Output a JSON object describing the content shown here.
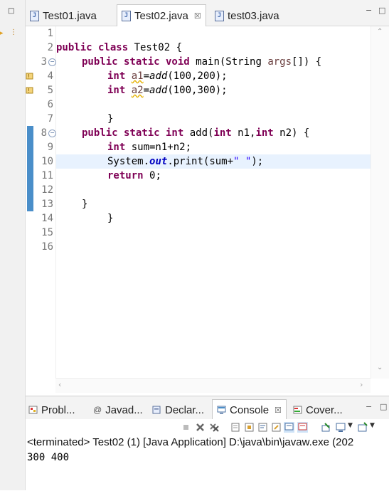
{
  "editor_tabs": [
    {
      "label": "Test01.java",
      "active": false
    },
    {
      "label": "Test02.java",
      "active": true
    },
    {
      "label": "test03.java",
      "active": false
    }
  ],
  "line_numbers": [
    "1",
    "2",
    "3",
    "4",
    "5",
    "6",
    "7",
    "8",
    "9",
    "10",
    "11",
    "12",
    "13",
    "14",
    "15",
    "16"
  ],
  "code": {
    "l2": {
      "kw": "public class ",
      "rest": "Test02 {"
    },
    "l3": {
      "kw": "public static void ",
      "rest": "main(String ",
      "arg": "args",
      "rest2": "[]) {"
    },
    "l4": {
      "kw": "int ",
      "var": "a1",
      "eq": "=",
      "fn": "add",
      "args": "(100,200);"
    },
    "l5": {
      "kw": "int ",
      "var": "a2",
      "eq": "=",
      "fn": "add",
      "args": "(100,300);"
    },
    "l7": {
      "brace": "}"
    },
    "l8": {
      "kw": "public static int ",
      "name": "add(",
      "kw2": "int ",
      "p1": "n1,",
      "kw3": "int ",
      "p2": "n2) {"
    },
    "l9": {
      "kw": "int ",
      "rest": "sum=n1+n2;"
    },
    "l10": {
      "pre": "System.",
      "field": "out",
      "mid": ".print(sum+",
      "str": "\" \"",
      "end": ");"
    },
    "l11": {
      "kw": "return ",
      "rest": "0;"
    },
    "l13": {
      "brace": "}"
    },
    "l14": {
      "brace": "}"
    }
  },
  "panel_tabs": [
    {
      "label": "Probl...",
      "icon": "problems-icon",
      "active": false
    },
    {
      "label": "Javad...",
      "icon": "javadoc-icon",
      "active": false
    },
    {
      "label": "Declar...",
      "icon": "declaration-icon",
      "active": false
    },
    {
      "label": "Console",
      "icon": "console-icon",
      "active": true
    },
    {
      "label": "Cover...",
      "icon": "coverage-icon",
      "active": false
    }
  ],
  "console": {
    "status": "<terminated> Test02 (1) [Java Application] D:\\java\\bin\\javaw.exe  (202",
    "output": "300 400"
  },
  "colors": {
    "keyword": "#7f0055",
    "field": "#0000c0",
    "string": "#2a00ff",
    "current_line": "#e8f2fe",
    "change_bar": "#4a8ec9"
  }
}
